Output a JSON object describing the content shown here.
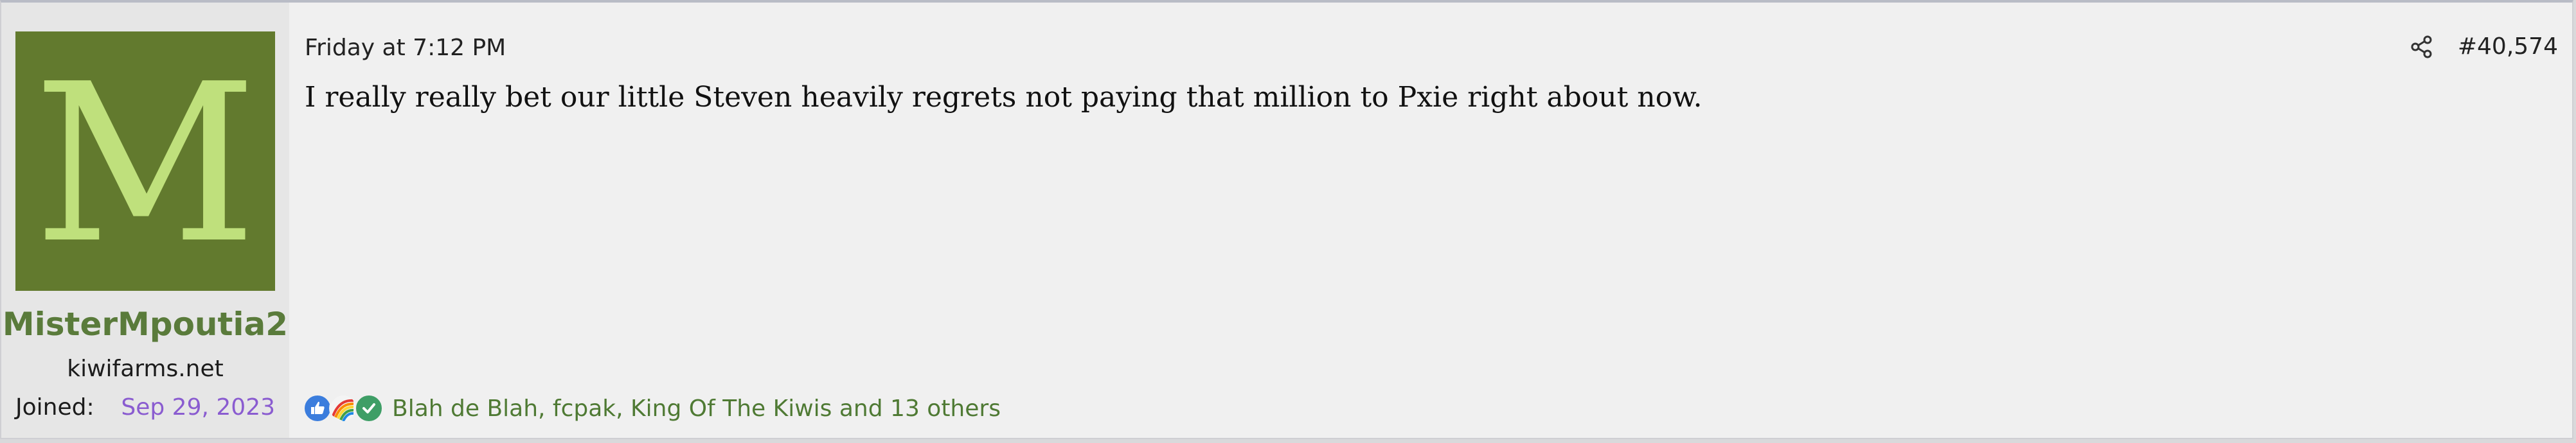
{
  "post": {
    "user": {
      "avatar_letter": "M",
      "avatar_bg": "#627a2e",
      "avatar_fg": "#bfe07c",
      "username": "MisterMpoutia2",
      "title": "kiwifarms.net",
      "joined_label": "Joined:",
      "joined_date": "Sep 29, 2023"
    },
    "date": "Friday at 7:12 PM",
    "share_icon": "share-icon",
    "post_number": "#40,574",
    "message": "I really really bet our little Steven heavily regrets not paying that million to Pxie right about now.",
    "reactions": {
      "icons": [
        "like-icon",
        "rainbow-icon",
        "check-icon"
      ],
      "text": "Blah de Blah, fcpak, King Of The Kiwis and 13 others"
    }
  }
}
